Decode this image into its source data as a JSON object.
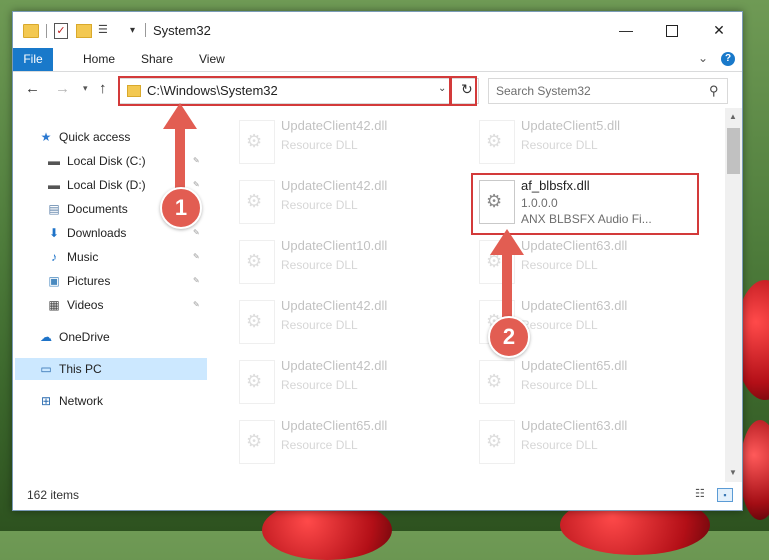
{
  "window": {
    "title": "System32",
    "controls": {
      "minimize": "—",
      "maximize": "",
      "close": "✕"
    }
  },
  "ribbon": {
    "tabs": [
      "File",
      "Home",
      "Share",
      "View"
    ],
    "expand_glyph": "⌄",
    "help_glyph": "?"
  },
  "address": {
    "path": "C:\\Windows\\System32",
    "search_placeholder": "Search System32"
  },
  "nav_pane": {
    "items": [
      {
        "label": "Quick access",
        "icon": "star-icon",
        "glyph": "★",
        "color": "#2b78d0",
        "pinned": false
      },
      {
        "label": "Local Disk (C:)",
        "icon": "drive-icon",
        "glyph": "▬",
        "color": "#555555",
        "pinned": true
      },
      {
        "label": "Local Disk (D:)",
        "icon": "drive-icon",
        "glyph": "▬",
        "color": "#555555",
        "pinned": true
      },
      {
        "label": "Documents",
        "icon": "documents-icon",
        "glyph": "▤",
        "color": "#5a7fa8",
        "pinned": true
      },
      {
        "label": "Downloads",
        "icon": "download-icon",
        "glyph": "⬇",
        "color": "#1e73c8",
        "pinned": true
      },
      {
        "label": "Music",
        "icon": "music-icon",
        "glyph": "♪",
        "color": "#1e73c8",
        "pinned": true
      },
      {
        "label": "Pictures",
        "icon": "pictures-icon",
        "glyph": "▣",
        "color": "#4a8ac0",
        "pinned": true
      },
      {
        "label": "Videos",
        "icon": "videos-icon",
        "glyph": "▦",
        "color": "#444444",
        "pinned": true
      },
      {
        "label": "OneDrive",
        "icon": "cloud-icon",
        "glyph": "☁",
        "color": "#1e73c8",
        "pinned": false
      },
      {
        "label": "This PC",
        "icon": "computer-icon",
        "glyph": "▭",
        "color": "#2b6cb0",
        "pinned": false
      },
      {
        "label": "Network",
        "icon": "network-icon",
        "glyph": "⊞",
        "color": "#2b6cb0",
        "pinned": false
      }
    ]
  },
  "files": {
    "left_column": [
      {
        "name": "UpdateClient42.dll",
        "type": "Resource DLL"
      },
      {
        "name": "UpdateClient42.dll",
        "type": "Resource DLL"
      },
      {
        "name": "UpdateClient10.dll",
        "type": "Resource DLL"
      },
      {
        "name": "UpdateClient42.dll",
        "type": "Resource DLL"
      },
      {
        "name": "UpdateClient42.dll",
        "type": "Resource DLL"
      },
      {
        "name": "UpdateClient65.dll",
        "type": "Resource DLL"
      }
    ],
    "right_column": [
      {
        "name": "UpdateClient5.dll",
        "type": "Resource DLL"
      },
      {
        "name": "af_blbsfx.dll",
        "version": "1.0.0.0",
        "description": "ANX BLBSFX Audio Fi..."
      },
      {
        "name": "UpdateClient63.dll",
        "type": "Resource DLL"
      },
      {
        "name": "UpdateClient63.dll",
        "type": "Resource DLL"
      },
      {
        "name": "UpdateClient65.dll",
        "type": "Resource DLL"
      },
      {
        "name": "UpdateClient63.dll",
        "type": "Resource DLL"
      }
    ]
  },
  "status": {
    "item_count": "162 items"
  },
  "annotations": {
    "step1": "1",
    "step2": "2",
    "color": "#e25d52"
  }
}
